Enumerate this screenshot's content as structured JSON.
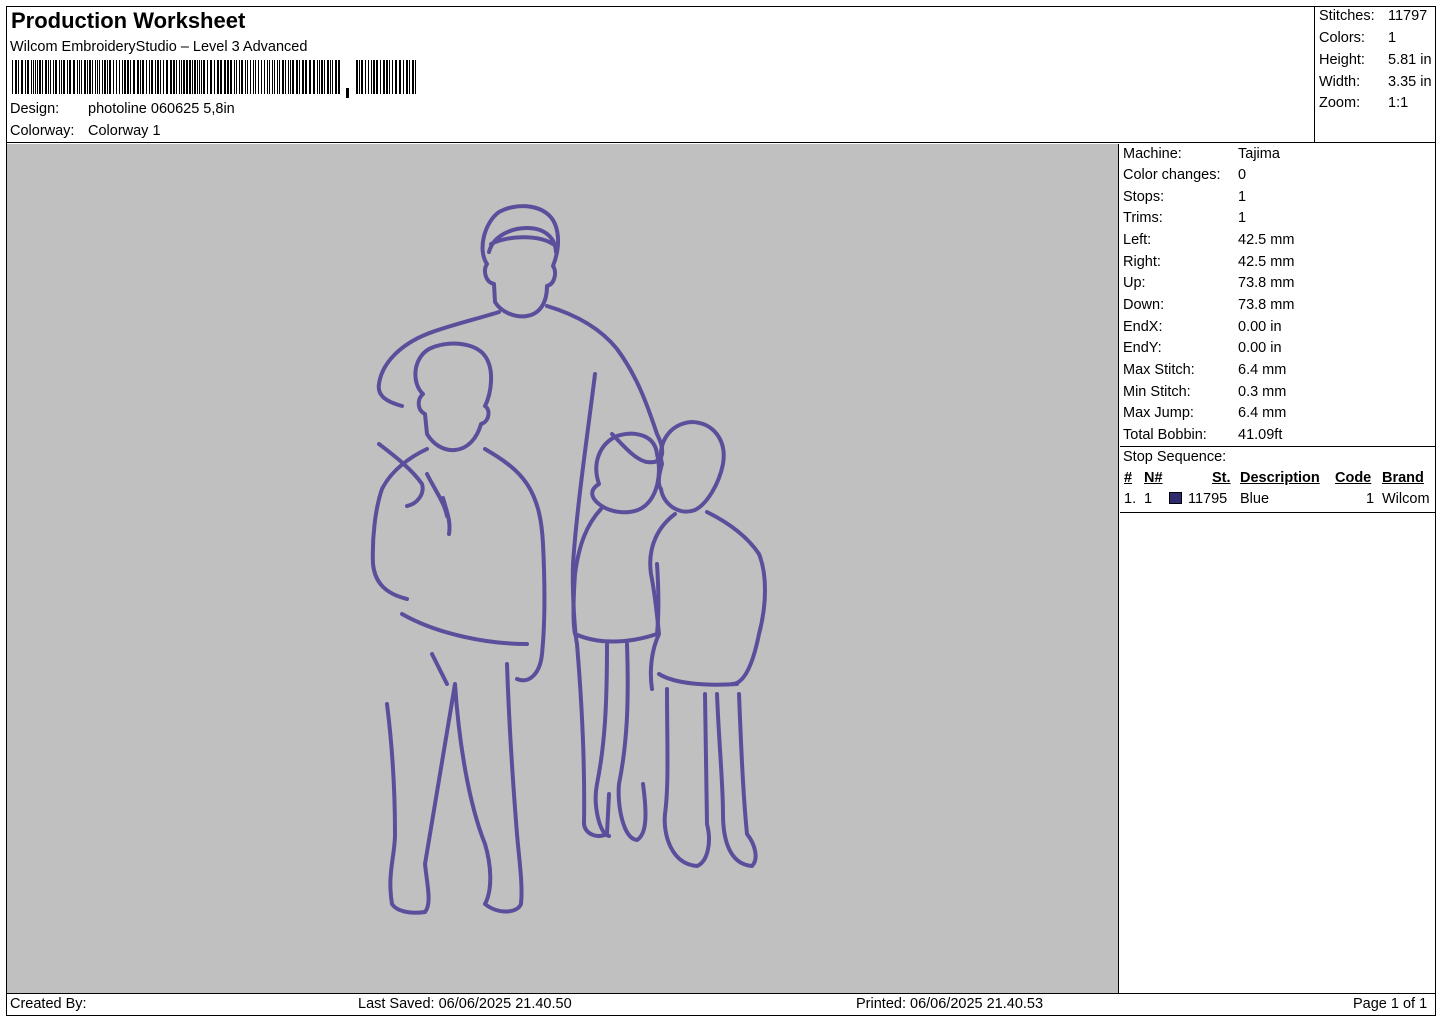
{
  "header": {
    "title": "Production Worksheet",
    "software": "Wilcom EmbroideryStudio – Level 3 Advanced",
    "design_label": "Design:",
    "design_value": "photoline 060625 5,8in",
    "colorway_label": "Colorway:",
    "colorway_value": "Colorway 1"
  },
  "summary": {
    "stitches_label": "Stitches:",
    "stitches": "11797",
    "colors_label": "Colors:",
    "colors": "1",
    "height_label": "Height:",
    "height": "5.81 in",
    "width_label": "Width:",
    "width": "3.35 in",
    "zoom_label": "Zoom:",
    "zoom": "1:1"
  },
  "details": {
    "machine_label": "Machine:",
    "machine": "Tajima",
    "color_changes_label": "Color changes:",
    "color_changes": "0",
    "stops_label": "Stops:",
    "stops": "1",
    "trims_label": "Trims:",
    "trims": "1",
    "left_label": "Left:",
    "left": "42.5 mm",
    "right_label": "Right:",
    "right": "42.5 mm",
    "up_label": "Up:",
    "up": "73.8 mm",
    "down_label": "Down:",
    "down": "73.8 mm",
    "endx_label": "EndX:",
    "endx": "0.00 in",
    "endy_label": "EndY:",
    "endy": "0.00 in",
    "max_stitch_label": "Max Stitch:",
    "max_stitch": "6.4 mm",
    "min_stitch_label": "Min Stitch:",
    "min_stitch": "0.3 mm",
    "max_jump_label": "Max Jump:",
    "max_jump": "6.4 mm",
    "total_bobbin_label": "Total Bobbin:",
    "total_bobbin": "41.09ft"
  },
  "stop_sequence": {
    "label": "Stop Sequence:",
    "headers": {
      "num": "#",
      "n": "N#",
      "st": "St.",
      "description": "Description",
      "code": "Code",
      "brand": "Brand"
    },
    "rows": [
      {
        "num": "1.",
        "n": "1",
        "st": "11795",
        "description": "Blue",
        "code": "1",
        "brand": "Wilcom",
        "color": "#2e2a6e"
      }
    ]
  },
  "canvas": {
    "background": "#c0c0c0",
    "thread_color": "#5b4f9c"
  },
  "footer": {
    "created_by": "Created By:",
    "last_saved": "Last Saved: 06/06/2025 21.40.50",
    "printed": "Printed: 06/06/2025 21.40.53",
    "page": "Page 1 of 1"
  }
}
